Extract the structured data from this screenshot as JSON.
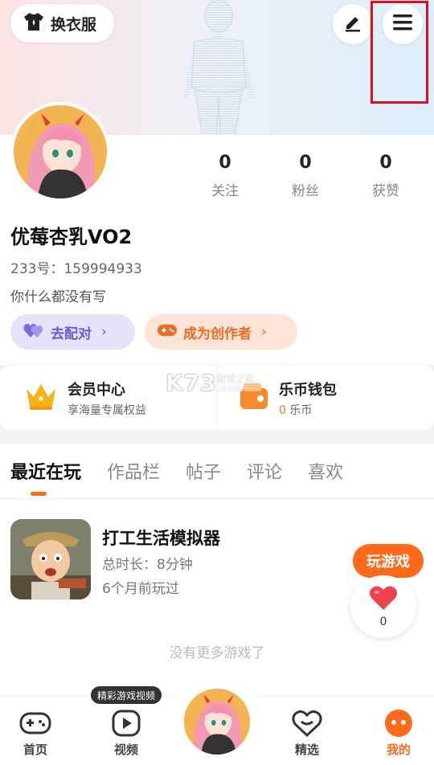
{
  "header": {
    "outfit_label": "换衣服",
    "outfit_icon": "tshirt-icon",
    "edit_icon": "pen-icon",
    "menu_icon": "hamburger-menu-icon"
  },
  "profile": {
    "nickname": "优莓杏乳VO2",
    "uid": "233号：159994933",
    "bio": "你什么都没有写",
    "stats": [
      {
        "value": "0",
        "label": "关注"
      },
      {
        "value": "0",
        "label": "粉丝"
      },
      {
        "value": "0",
        "label": "获赞"
      }
    ],
    "match_label": "去配对",
    "creator_label": "成为创作者"
  },
  "cards": {
    "vip_title": "会员中心",
    "vip_sub": "享海量专属权益",
    "wallet_title": "乐币钱包",
    "wallet_amount": "0",
    "wallet_unit": " 乐币"
  },
  "watermark": {
    "text": "K73",
    "small1": "游戏之家",
    "small2": ".com"
  },
  "tabs": [
    "最近在玩",
    "作品栏",
    "帖子",
    "评论",
    "喜欢"
  ],
  "games": [
    {
      "title": "打工生活模拟器",
      "duration": "总时长：8分钟",
      "last_played": "6个月前玩过"
    }
  ],
  "play_label": "玩游戏",
  "like_count": "0",
  "no_more": "没有更多游戏了",
  "nav": {
    "home": "首页",
    "video": "视频",
    "featured": "精选",
    "mine": "我的",
    "tooltip": "精彩游戏视频"
  },
  "colors": {
    "accent": "#ff6a1a",
    "purple": "#6a5ad8",
    "highlight": "#e0101a"
  }
}
